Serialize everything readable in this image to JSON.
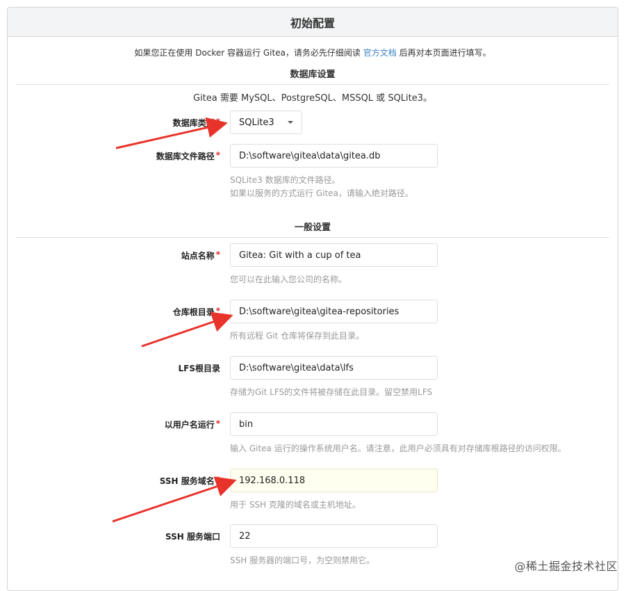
{
  "header": {
    "title": "初始配置"
  },
  "notice": {
    "before": "如果您正在使用 Docker 容器运行 Gitea，请务必先仔细阅读 ",
    "link": "官方文档",
    "after": " 后再对本页面进行填写。"
  },
  "database": {
    "section_title": "数据库设置",
    "description": "Gitea 需要 MySQL、PostgreSQL、MSSQL 或 SQLite3。",
    "type_label": "数据库类型",
    "type_value": "SQLite3",
    "path_label": "数据库文件路径",
    "path_value": "D:\\software\\gitea\\data\\gitea.db",
    "path_help_1": "SQLite3 数据库的文件路径。",
    "path_help_2": "如果以服务的方式运行 Gitea，请输入绝对路径。"
  },
  "general": {
    "section_title": "一般设置",
    "site_name_label": "站点名称",
    "site_name_value": "Gitea: Git with a cup of tea",
    "site_name_help": "您可以在此输入您公司的名称。",
    "repo_root_label": "仓库根目录",
    "repo_root_value": "D:\\software\\gitea\\gitea-repositories",
    "repo_root_help": "所有远程 Git 仓库将保存到此目录。",
    "lfs_label": "LFS根目录",
    "lfs_value": "D:\\software\\gitea\\data\\lfs",
    "lfs_help": "存储为Git LFS的文件将被存储在此目录。留空禁用LFS",
    "run_user_label": "以用户名运行",
    "run_user_value": "bin",
    "run_user_help": "输入 Gitea 运行的操作系统用户名。请注意，此用户必须具有对存储库根路径的访问权限。",
    "ssh_domain_label": "SSH 服务域名",
    "ssh_domain_value": "192.168.0.118",
    "ssh_domain_help": "用于 SSH 克隆的域名或主机地址。",
    "ssh_port_label": "SSH 服务端口",
    "ssh_port_value": "22",
    "ssh_port_help": "SSH 服务器的端口号，为空则禁用它。"
  },
  "required_mark": "*",
  "watermark": "@稀土掘金技术社区",
  "colors": {
    "arrow": "#e8332a",
    "link": "#4183c4",
    "required": "#db2828"
  }
}
